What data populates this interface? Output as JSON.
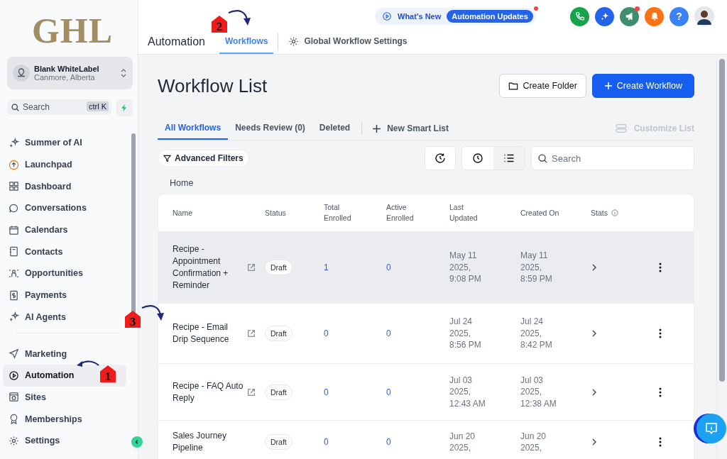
{
  "sidebar": {
    "logo": "GHL",
    "account": {
      "name": "Blank WhiteLabel",
      "location": "Canmore, Alberta"
    },
    "search": {
      "placeholder": "Search",
      "shortcut": "ctrl K"
    },
    "items": [
      {
        "label": "Summer of AI",
        "selected": false
      },
      {
        "label": "Launchpad",
        "selected": false
      },
      {
        "label": "Dashboard",
        "selected": false
      },
      {
        "label": "Conversations",
        "selected": false
      },
      {
        "label": "Calendars",
        "selected": false
      },
      {
        "label": "Contacts",
        "selected": false
      },
      {
        "label": "Opportunities",
        "selected": false
      },
      {
        "label": "Payments",
        "selected": false
      },
      {
        "label": "AI Agents",
        "selected": false
      }
    ],
    "bottom_items": [
      {
        "label": "Marketing",
        "selected": false
      },
      {
        "label": "Automation",
        "selected": true
      },
      {
        "label": "Sites",
        "selected": false
      },
      {
        "label": "Memberships",
        "selected": false
      },
      {
        "label": "Settings",
        "selected": false
      }
    ]
  },
  "header": {
    "section": "Automation",
    "tabs": [
      {
        "label": "Workflows",
        "selected": true
      },
      {
        "label": "Global Workflow Settings",
        "selected": false
      }
    ],
    "whats_new": "What's New",
    "updates_badge": "Automation Updates",
    "help": "?"
  },
  "page": {
    "title": "Workflow List",
    "create_folder": "Create Folder",
    "create_workflow": "Create Workflow",
    "list_tabs": [
      {
        "label": "All Workflows",
        "selected": true
      },
      {
        "label": "Needs Review (0)",
        "selected": false
      },
      {
        "label": "Deleted",
        "selected": false
      }
    ],
    "new_smart_list": "New Smart List",
    "customize_list": "Customize List",
    "advanced_filters": "Advanced Filters",
    "search": {
      "placeholder": "Search"
    },
    "breadcrumb": "Home"
  },
  "table": {
    "columns": [
      "Name",
      "Status",
      "Total Enrolled",
      "Active Enrolled",
      "Last Updated",
      "Created On",
      "Stats"
    ],
    "rows": [
      {
        "name": "Recipe - Appointment Confirmation + Reminder",
        "status": "Draft",
        "total": "1",
        "active": "0",
        "updated": "May 11 2025, 9:08 PM",
        "created": "May 11 2025, 8:59 PM",
        "highlighted": true
      },
      {
        "name": "Recipe - Email Drip Sequence",
        "status": "Draft",
        "total": "0",
        "active": "0",
        "updated": "Jul 24 2025, 8:56 PM",
        "created": "Jul 24 2025, 8:42 PM",
        "highlighted": false
      },
      {
        "name": "Recipe - FAQ Auto Reply",
        "status": "Draft",
        "total": "0",
        "active": "0",
        "updated": "Jul 03 2025, 12:43 AM",
        "created": "Jul 03 2025, 12:38 AM",
        "highlighted": false
      },
      {
        "name": "Sales Journey Pipeline",
        "status": "Draft",
        "total": "0",
        "active": "0",
        "updated": "Jun 20 2025,",
        "created": "Jun 20 2025,",
        "highlighted": false
      }
    ]
  },
  "callouts": [
    {
      "number": "1"
    },
    {
      "number": "2"
    },
    {
      "number": "3"
    }
  ]
}
